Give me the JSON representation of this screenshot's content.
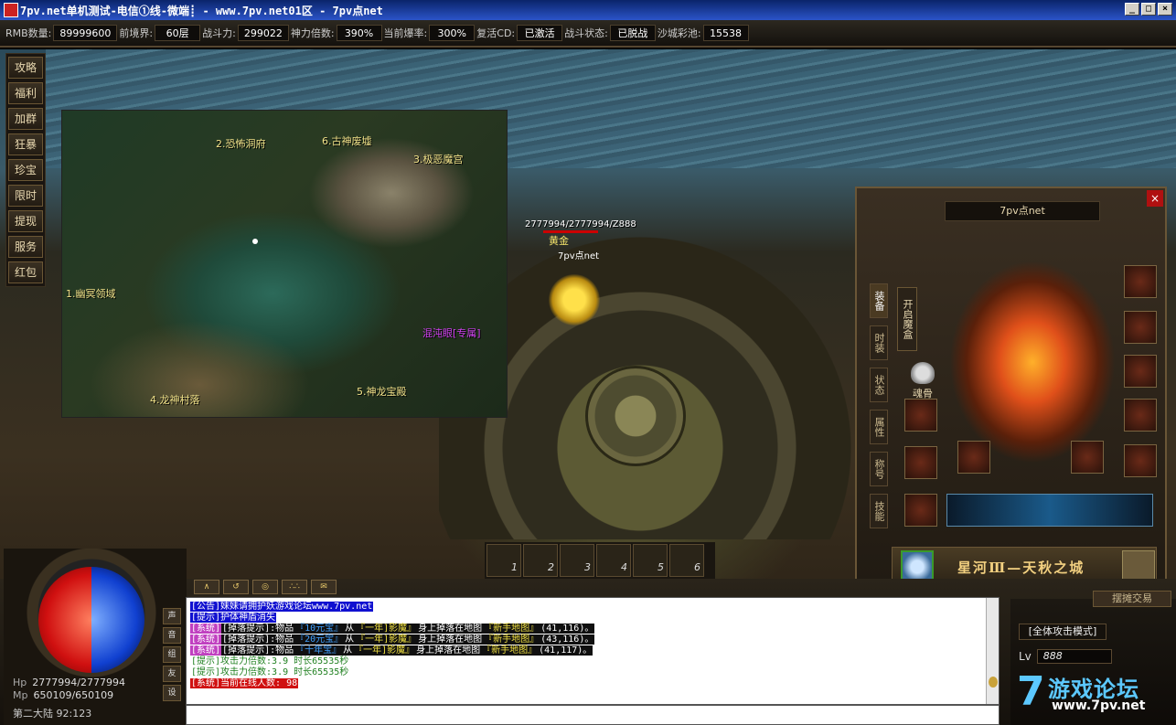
{
  "window": {
    "title": "7pv.net单机测试-电信①线-微端┋ - www.7pv.net01区 - 7pv点net",
    "controls": [
      "_",
      "□",
      "×"
    ]
  },
  "stats": [
    {
      "label": "RMB数量:",
      "value": "89999600"
    },
    {
      "label": "前境界:",
      "value": "60层"
    },
    {
      "label": "战斗力:",
      "value": "299022"
    },
    {
      "label": "神力倍数:",
      "value": "390%"
    },
    {
      "label": "当前爆率:",
      "value": "300%"
    },
    {
      "label": "复活CD:",
      "value": "已激活"
    },
    {
      "label": "战斗状态:",
      "value": "已脱战"
    },
    {
      "label": "沙城彩池:",
      "value": "15538"
    }
  ],
  "sidemenu": [
    "攻略",
    "福利",
    "加群",
    "狂暴",
    "珍宝",
    "限时",
    "提现",
    "服务",
    "红包"
  ],
  "minimap": {
    "locations": [
      {
        "label": "2.恐怖洞府",
        "style": "normal"
      },
      {
        "label": "6.古神废墟",
        "style": "normal"
      },
      {
        "label": "3.极恶魔宫",
        "style": "normal"
      },
      {
        "label": "1.幽冥领域",
        "style": "normal"
      },
      {
        "label": "混沌眼[专属]",
        "style": "purple"
      },
      {
        "label": "5.神龙宝殿",
        "style": "normal"
      },
      {
        "label": "4.龙神村落",
        "style": "normal"
      }
    ]
  },
  "player": {
    "coords": "2777994/2777994/Z888",
    "name": "黄金",
    "guild": "7pv点net"
  },
  "equip_panel": {
    "title": "7pv点net",
    "close": "×",
    "tabs": [
      "装备",
      "时装",
      "状态",
      "属性",
      "称号",
      "技能"
    ],
    "open_button": "开启魔盒",
    "soulbone_label": "魂骨",
    "zone_name": "星河Ⅲ—天秋之城"
  },
  "skillbar": {
    "slots": [
      "1",
      "2",
      "3",
      "4",
      "5",
      "6"
    ]
  },
  "hud": {
    "hp_label": "Hp",
    "hp_value": "2777994/2777994",
    "mp_label": "Mp",
    "mp_value": "650109/650109",
    "map_line": "第二大陆 92:123",
    "side_icons": [
      "声",
      "音",
      "组",
      "友",
      "设"
    ],
    "chat_buttons": [
      "∧",
      "↺",
      "◎",
      "∴∴",
      "✉"
    ],
    "attack_mode": "[全体攻击模式]",
    "level_label": "Lv",
    "level_value": "888",
    "top_right_button": "摆摊交易"
  },
  "chat": {
    "lines": [
      [
        {
          "text": "[公告]妹妹请拥护妖游戏论坛www.7pv.net",
          "color": "#ffffff",
          "bg": "#1010d0"
        }
      ],
      [
        {
          "text": "[提示]护体神盾消失",
          "color": "#ffffff",
          "bg": "#1010d0"
        }
      ],
      [
        {
          "text": "[系统]",
          "color": "#ffffff",
          "bg": "#c040c0"
        },
        {
          "text": "[掉落提示]:物品",
          "color": "#ffffff",
          "bg": "#101010"
        },
        {
          "text": "『10元宝』",
          "color": "#40a0ff",
          "bg": "#101010"
        },
        {
          "text": "从",
          "color": "#ffffff",
          "bg": "#101010"
        },
        {
          "text": "『一年]影魔』",
          "color": "#f0e040",
          "bg": "#101010"
        },
        {
          "text": "身上掉落在地图",
          "color": "#ffffff",
          "bg": "#101010"
        },
        {
          "text": "『新手地图』",
          "color": "#f0e040",
          "bg": "#101010"
        },
        {
          "text": "(41,116)。",
          "color": "#ffffff",
          "bg": "#101010"
        }
      ],
      [
        {
          "text": "[系统]",
          "color": "#ffffff",
          "bg": "#c040c0"
        },
        {
          "text": "[掉落提示]:物品",
          "color": "#ffffff",
          "bg": "#101010"
        },
        {
          "text": "『20元宝』",
          "color": "#40a0ff",
          "bg": "#101010"
        },
        {
          "text": "从",
          "color": "#ffffff",
          "bg": "#101010"
        },
        {
          "text": "『一年]影魔』",
          "color": "#f0e040",
          "bg": "#101010"
        },
        {
          "text": "身上掉落在地图",
          "color": "#ffffff",
          "bg": "#101010"
        },
        {
          "text": "『新手地图』",
          "color": "#f0e040",
          "bg": "#101010"
        },
        {
          "text": "(43,116)。",
          "color": "#ffffff",
          "bg": "#101010"
        }
      ],
      [
        {
          "text": "[系统]",
          "color": "#ffffff",
          "bg": "#c040c0"
        },
        {
          "text": "[掉落提示]:物品",
          "color": "#ffffff",
          "bg": "#101010"
        },
        {
          "text": "『十年宝』",
          "color": "#40a0ff",
          "bg": "#101010"
        },
        {
          "text": "从",
          "color": "#ffffff",
          "bg": "#101010"
        },
        {
          "text": "『一年]影魔』",
          "color": "#f0e040",
          "bg": "#101010"
        },
        {
          "text": "身上掉落在地图",
          "color": "#ffffff",
          "bg": "#101010"
        },
        {
          "text": "『新手地图』",
          "color": "#f0e040",
          "bg": "#101010"
        },
        {
          "text": "(41,117)。",
          "color": "#ffffff",
          "bg": "#101010"
        }
      ],
      [
        {
          "text": "[提示]攻击力倍数:3.9 时长65535秒",
          "color": "#208020",
          "bg": "transparent"
        }
      ],
      [
        {
          "text": "[提示]攻击力倍数:3.9 时长65535秒",
          "color": "#208020",
          "bg": "transparent"
        }
      ],
      [
        {
          "text": "[系统]当前在线人数: 98",
          "color": "#ffffff",
          "bg": "#d01010"
        }
      ]
    ]
  },
  "watermark": {
    "seven": "7",
    "forum": "游戏论坛",
    "site": "www.7pv.net"
  }
}
